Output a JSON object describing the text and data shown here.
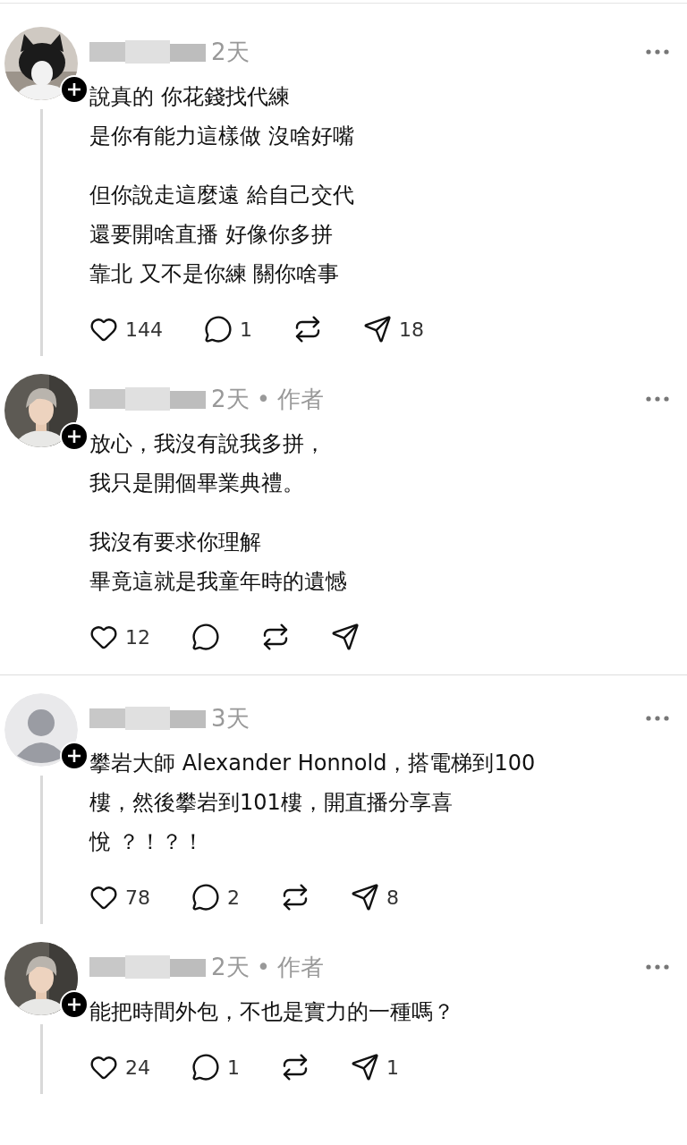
{
  "comments": [
    {
      "avatar": {
        "kind": "cat-photo"
      },
      "meta": "2天",
      "paragraphs": [
        [
          "說真的 你花錢找代練",
          "是你有能力這樣做  沒啥好嘴"
        ],
        [
          "但你說走這麼遠 給自己交代",
          "還要開啥直播 好像你多拼",
          "靠北 又不是你練 關你啥事"
        ]
      ],
      "stats": {
        "likes": "144",
        "replies": "1",
        "shares": "18"
      },
      "thread_line": true,
      "divider_after": false
    },
    {
      "avatar": {
        "kind": "person-photo"
      },
      "meta": "2天 • 作者",
      "paragraphs": [
        [
          "放心，我沒有說我多拼，",
          "我只是開個畢業典禮。"
        ],
        [
          "我沒有要求你理解",
          "畢竟這就是我童年時的遺憾"
        ]
      ],
      "stats": {
        "likes": "12"
      },
      "thread_line": false,
      "divider_after": true
    },
    {
      "avatar": {
        "kind": "default"
      },
      "meta": "3天",
      "paragraphs": [
        [
          "攀岩大師 Alexander Honnold，搭電梯到100",
          "樓，然後攀岩到101樓，開直播分享喜",
          "悅 ？！？！"
        ]
      ],
      "stats": {
        "likes": "78",
        "replies": "2",
        "shares": "8"
      },
      "thread_line": true,
      "divider_after": false
    },
    {
      "avatar": {
        "kind": "person-photo"
      },
      "meta": "2天 • 作者",
      "paragraphs": [
        [
          "能把時間外包，不也是實力的一種嗎？"
        ]
      ],
      "stats": {
        "likes": "24",
        "replies": "1",
        "shares": "1"
      },
      "thread_line": true,
      "divider_after": false
    }
  ]
}
